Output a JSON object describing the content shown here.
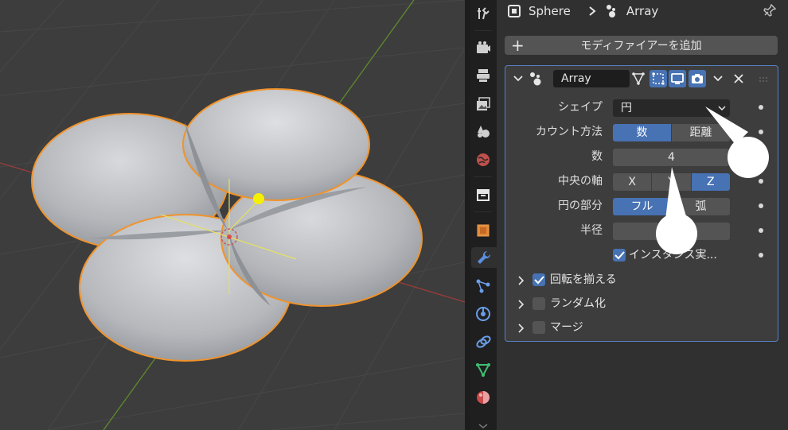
{
  "breadcrumb": {
    "object": "Sphere",
    "modifier": "Array"
  },
  "add_modifier": {
    "label": "モディファイアーを追加"
  },
  "modifier": {
    "name": "Array",
    "fields": {
      "shape": {
        "label": "シェイプ",
        "value": "円"
      },
      "count_method": {
        "label": "カウント方法",
        "options": [
          "数",
          "距離"
        ],
        "selected": "数"
      },
      "count": {
        "label": "数",
        "value": "4"
      },
      "axis": {
        "label": "中央の軸",
        "options": [
          "X",
          "Y",
          "Z"
        ],
        "selected": "Z"
      },
      "circle_part": {
        "label": "円の部分",
        "options": [
          "フル",
          "弧"
        ],
        "selected": "フル"
      },
      "radius": {
        "label": "半径",
        "value": ""
      },
      "instance": {
        "label": "インスタンス実...",
        "checked": true
      }
    },
    "subpanels": [
      {
        "label": "回転を揃える",
        "checked": true
      },
      {
        "label": "ランダム化",
        "checked": false
      },
      {
        "label": "マージ",
        "checked": false
      }
    ]
  },
  "colors": {
    "accent": "#4772b3",
    "selection_outline": "#f0932b",
    "panel_bg": "#303030",
    "field_bg": "#545454"
  },
  "icons": [
    "tool-icon",
    "render-icon",
    "output-icon",
    "view-layer-icon",
    "scene-icon",
    "world-icon",
    "collection-icon",
    "object-icon",
    "modifier-wrench-icon",
    "particles-icon",
    "physics-icon",
    "constraints-icon",
    "data-icon",
    "material-icon",
    "pin-icon",
    "array-modifier-icon",
    "edit-mode-icon",
    "realtime-icon",
    "render-camera-icon"
  ]
}
